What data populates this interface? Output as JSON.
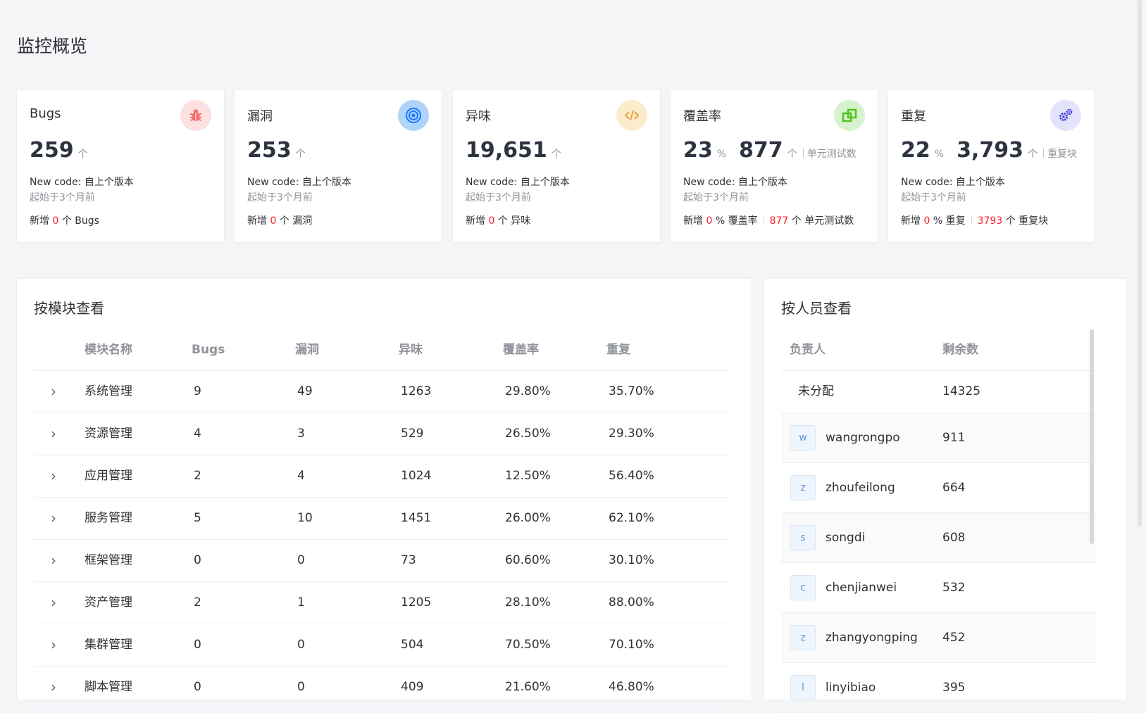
{
  "page_title": "监控概览",
  "colors": {
    "red": "#f5222d",
    "bug_bg": "#fde0e0",
    "vuln_bg": "#aed4fb",
    "smell_bg": "#fbeccb",
    "coverage_bg": "#d7f2cf",
    "dup_bg": "#e3e3fb"
  },
  "cards": {
    "bugs": {
      "title": "Bugs",
      "icon": "bug-icon",
      "value": "259",
      "unit": "个",
      "new_code": "New code: 自上个版本",
      "since": "起始于3个月前",
      "foot_prefix": "新增",
      "foot_value": "0",
      "foot_suffix": "个 Bugs"
    },
    "vulns": {
      "title": "漏洞",
      "icon": "target-icon",
      "value": "253",
      "unit": "个",
      "new_code": "New code: 自上个版本",
      "since": "起始于3个月前",
      "foot_prefix": "新增",
      "foot_value": "0",
      "foot_suffix": "个 漏洞"
    },
    "smells": {
      "title": "异味",
      "icon": "code-icon",
      "value": "19,651",
      "unit": "个",
      "new_code": "New code: 自上个版本",
      "since": "起始于3个月前",
      "foot_prefix": "新增",
      "foot_value": "0",
      "foot_suffix": "个 异味"
    },
    "coverage": {
      "title": "覆盖率",
      "icon": "coverage-icon",
      "value": "23",
      "unit": "%",
      "value2": "877",
      "unit2": "个",
      "sub": "单元测试数",
      "new_code": "New code: 自上个版本",
      "since": "起始于3个月前",
      "foot_prefix": "新增",
      "foot_value": "0",
      "foot_suffix": "% 覆盖率",
      "foot_value2": "877",
      "foot_suffix2": "个 单元测试数"
    },
    "dups": {
      "title": "重复",
      "icon": "gears-icon",
      "value": "22",
      "unit": "%",
      "value2": "3,793",
      "unit2": "个",
      "sub": "重复块",
      "new_code": "New code: 自上个版本",
      "since": "起始于3个月前",
      "foot_prefix": "新增",
      "foot_value": "0",
      "foot_suffix": "% 重复",
      "foot_value2": "3793",
      "foot_suffix2": "个 重复块"
    }
  },
  "module_panel": {
    "title": "按模块查看",
    "headers": [
      "模块名称",
      "Bugs",
      "漏洞",
      "异味",
      "覆盖率",
      "重复"
    ],
    "rows": [
      [
        "系统管理",
        "9",
        "49",
        "1263",
        "29.80%",
        "35.70%"
      ],
      [
        "资源管理",
        "4",
        "3",
        "529",
        "26.50%",
        "29.30%"
      ],
      [
        "应用管理",
        "2",
        "4",
        "1024",
        "12.50%",
        "56.40%"
      ],
      [
        "服务管理",
        "5",
        "10",
        "1451",
        "26.00%",
        "62.10%"
      ],
      [
        "框架管理",
        "0",
        "0",
        "73",
        "60.60%",
        "30.10%"
      ],
      [
        "资产管理",
        "2",
        "1",
        "1205",
        "28.10%",
        "88.00%"
      ],
      [
        "集群管理",
        "0",
        "0",
        "504",
        "70.50%",
        "70.10%"
      ],
      [
        "脚本管理",
        "0",
        "0",
        "409",
        "21.60%",
        "46.80%"
      ]
    ]
  },
  "person_panel": {
    "title": "按人员查看",
    "headers": [
      "负责人",
      "剩余数"
    ],
    "unassigned": {
      "name": "未分配",
      "count": "14325"
    },
    "rows": [
      {
        "avatar": "w",
        "name": "wangrongpo",
        "count": "911"
      },
      {
        "avatar": "z",
        "name": "zhoufeilong",
        "count": "664"
      },
      {
        "avatar": "s",
        "name": "songdi",
        "count": "608"
      },
      {
        "avatar": "c",
        "name": "chenjianwei",
        "count": "532"
      },
      {
        "avatar": "z",
        "name": "zhangyongping",
        "count": "452"
      },
      {
        "avatar": "l",
        "name": "linyibiao",
        "count": "395"
      }
    ]
  }
}
